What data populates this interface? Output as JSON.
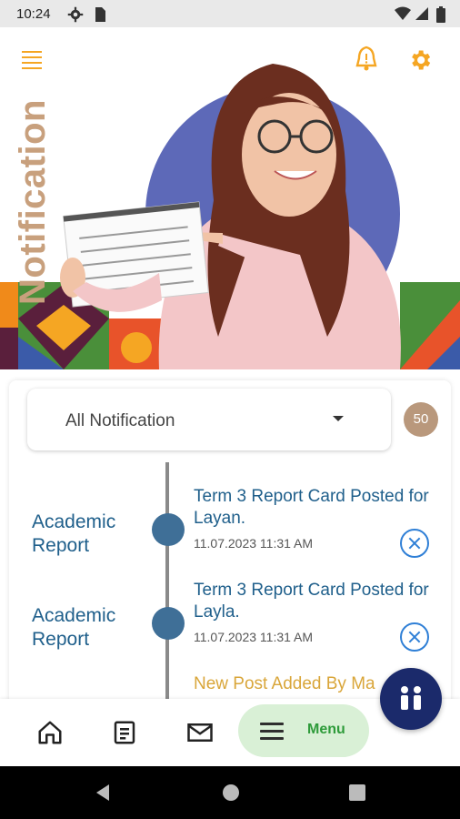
{
  "status_bar": {
    "time": "10:24"
  },
  "header": {
    "title": "Notification"
  },
  "filter": {
    "selected": "All Notification",
    "count": "50"
  },
  "notifications": [
    {
      "category": "Academic Report",
      "title": "Term 3 Report Card Posted for Layan.",
      "time": "11.07.2023 11:31 AM"
    },
    {
      "category": "Academic Report",
      "title": "Term 3 Report Card Posted for Layla.",
      "time": "11.07.2023 11:31 AM"
    },
    {
      "category": "",
      "title": "New Post Added By Ma",
      "time": ""
    }
  ],
  "bottom_nav": {
    "menu_label": "Menu",
    "items": [
      "home-icon",
      "document-icon",
      "mail-icon",
      "menu-icon"
    ]
  },
  "colors": {
    "accent_orange": "#f5a623",
    "title_tan": "#c8a07d",
    "item_blue": "#1f5f8b",
    "fab_navy": "#1b2a6b",
    "menu_green": "#2e9b3a"
  }
}
